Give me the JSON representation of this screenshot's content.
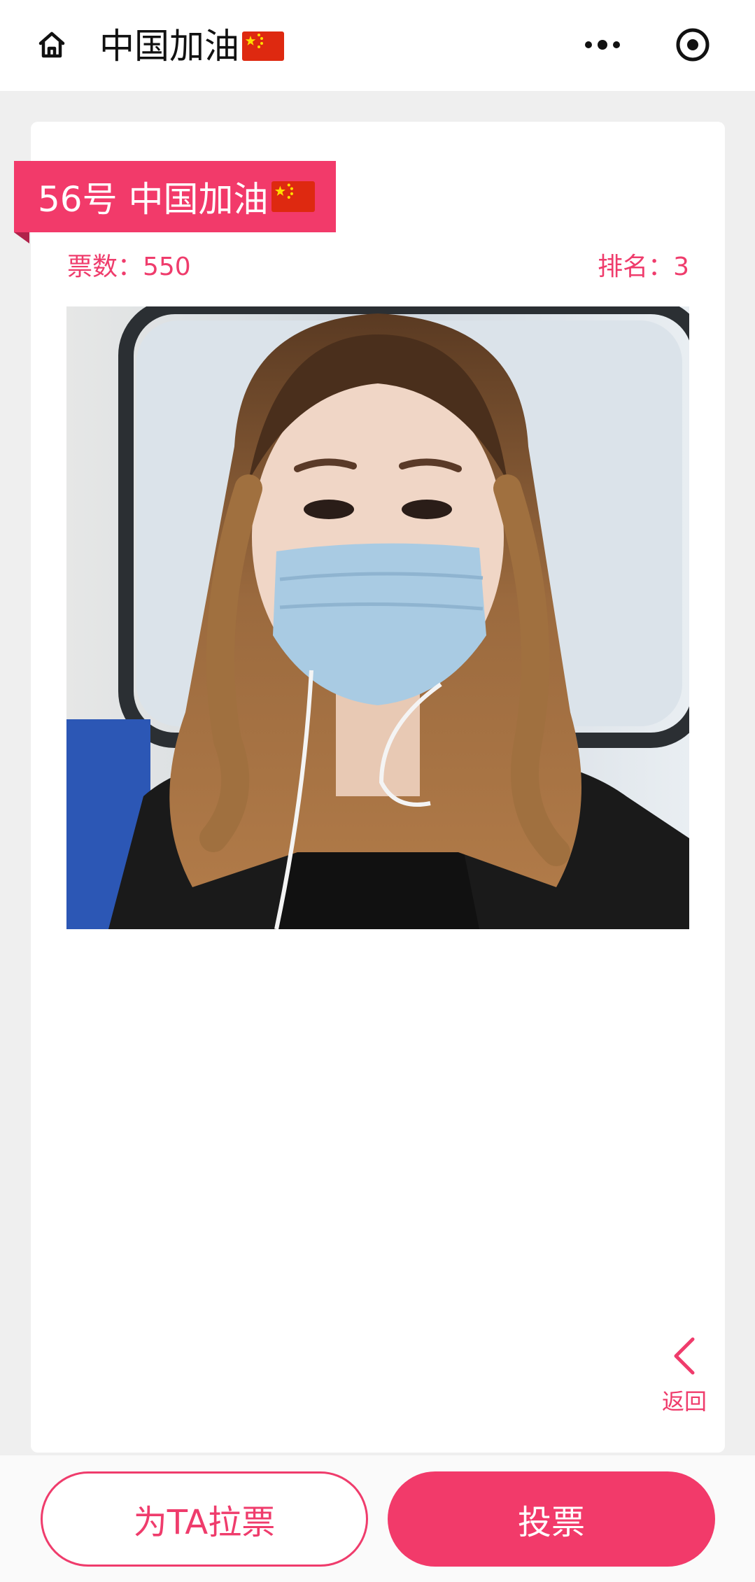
{
  "header": {
    "title": "中国加油",
    "home_icon": "home-icon",
    "more_icon": "more-dots-icon",
    "close_icon": "capsule-close-icon"
  },
  "entry": {
    "ribbon_text": "56号 中国加油",
    "votes_label": "票数：550",
    "rank_label": "排名：3",
    "photo_alt": "Portrait photo"
  },
  "back": {
    "label": "返回",
    "icon": "chevron-left-icon"
  },
  "actions": {
    "canvass_label": "为TA拉票",
    "vote_label": "投票"
  },
  "colors": {
    "accent": "#f23a6a",
    "accent_text": "#ef3c6c"
  }
}
